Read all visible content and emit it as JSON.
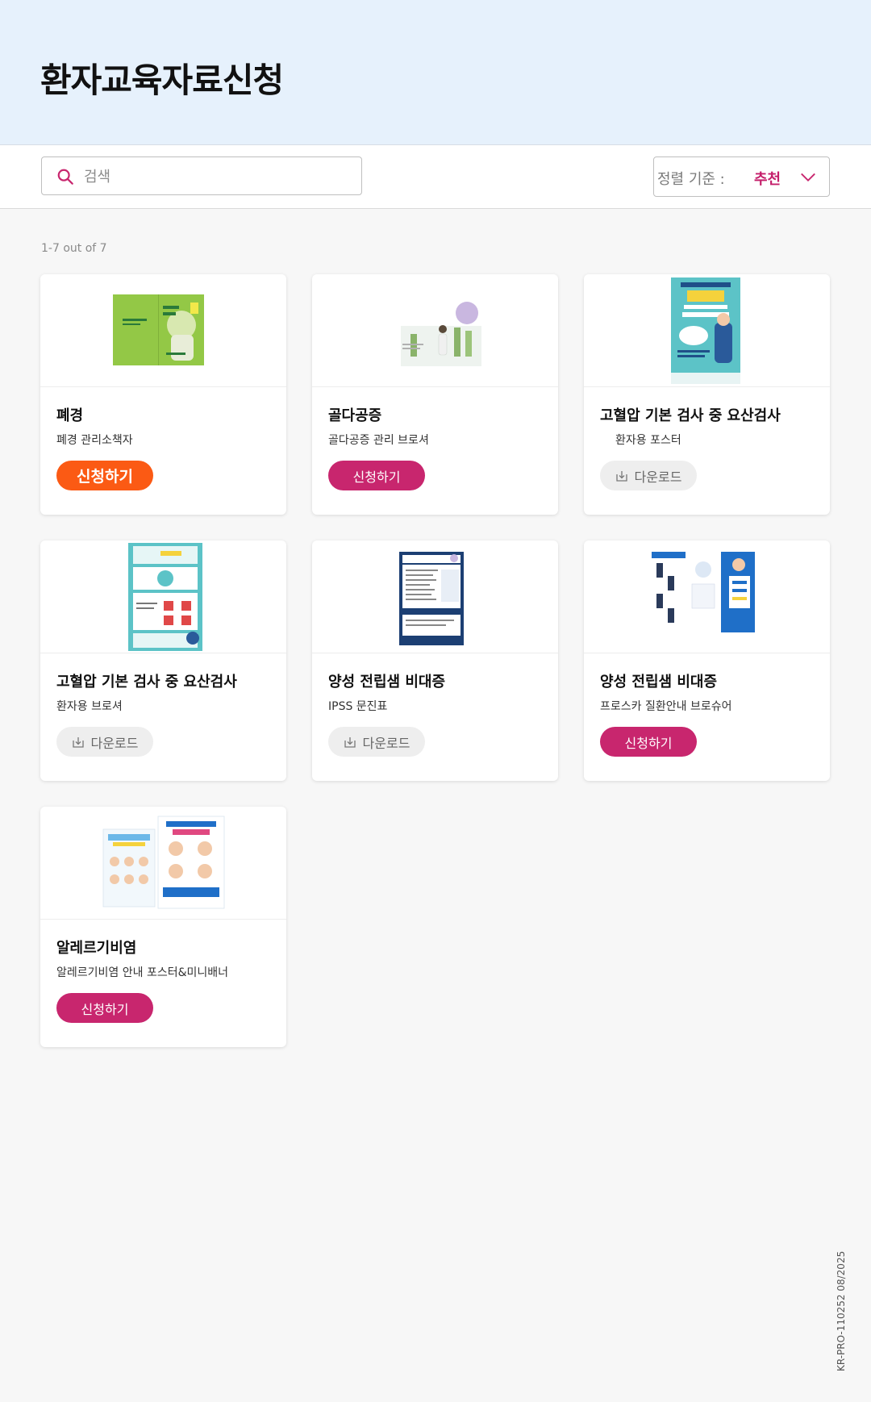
{
  "page": {
    "title": "환자교육자료신청"
  },
  "search": {
    "placeholder": "검색",
    "value": ""
  },
  "sort": {
    "label": "정렬 기준 :",
    "value": "추천"
  },
  "results": {
    "count_text": "1-7 out of 7"
  },
  "cards": [
    {
      "title": "폐경",
      "description": "폐경 관리소책자",
      "action": "신청하기",
      "action_type": "apply-primary"
    },
    {
      "title": "골다공증",
      "description": "골다공증 관리 브로셔",
      "action": "신청하기",
      "action_type": "apply"
    },
    {
      "title": "고혈압 기본 검사 중 요산검사",
      "description": "환자용 포스터",
      "action": "다운로드",
      "action_type": "download"
    },
    {
      "title": "고혈압 기본 검사 중 요산검사",
      "description": "환자용 브로셔",
      "action": "다운로드",
      "action_type": "download"
    },
    {
      "title": "양성 전립샘 비대증",
      "description": "IPSS 문진표",
      "action": "다운로드",
      "action_type": "download"
    },
    {
      "title": "양성 전립샘 비대증",
      "description": "프로스카 질환안내 브로슈어",
      "action": "신청하기",
      "action_type": "apply"
    },
    {
      "title": "알레르기비염",
      "description": "알레르기비염 안내 포스터&미니배너",
      "action": "신청하기",
      "action_type": "apply"
    }
  ],
  "footer": {
    "code": "KR-PRO-110252 08/2025"
  },
  "colors": {
    "accent": "#c8266e",
    "primary_orange": "#fb5a14",
    "header_bg": "#e6f1fc"
  },
  "icons": {
    "search": "search-icon",
    "sort": "chevron-down-icon",
    "download": "download-icon"
  }
}
